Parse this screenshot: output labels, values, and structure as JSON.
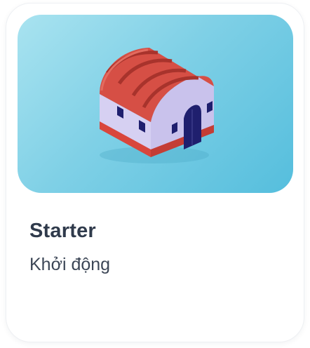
{
  "card": {
    "icon": "warehouse-icon",
    "title": "Starter",
    "subtitle": "Khởi động"
  },
  "colors": {
    "hero_background": "#7fd0e6",
    "roof": "#d64f45",
    "walls": "#d3cdf0",
    "door": "#1f1f6e",
    "title_text": "#2f3a4b"
  }
}
